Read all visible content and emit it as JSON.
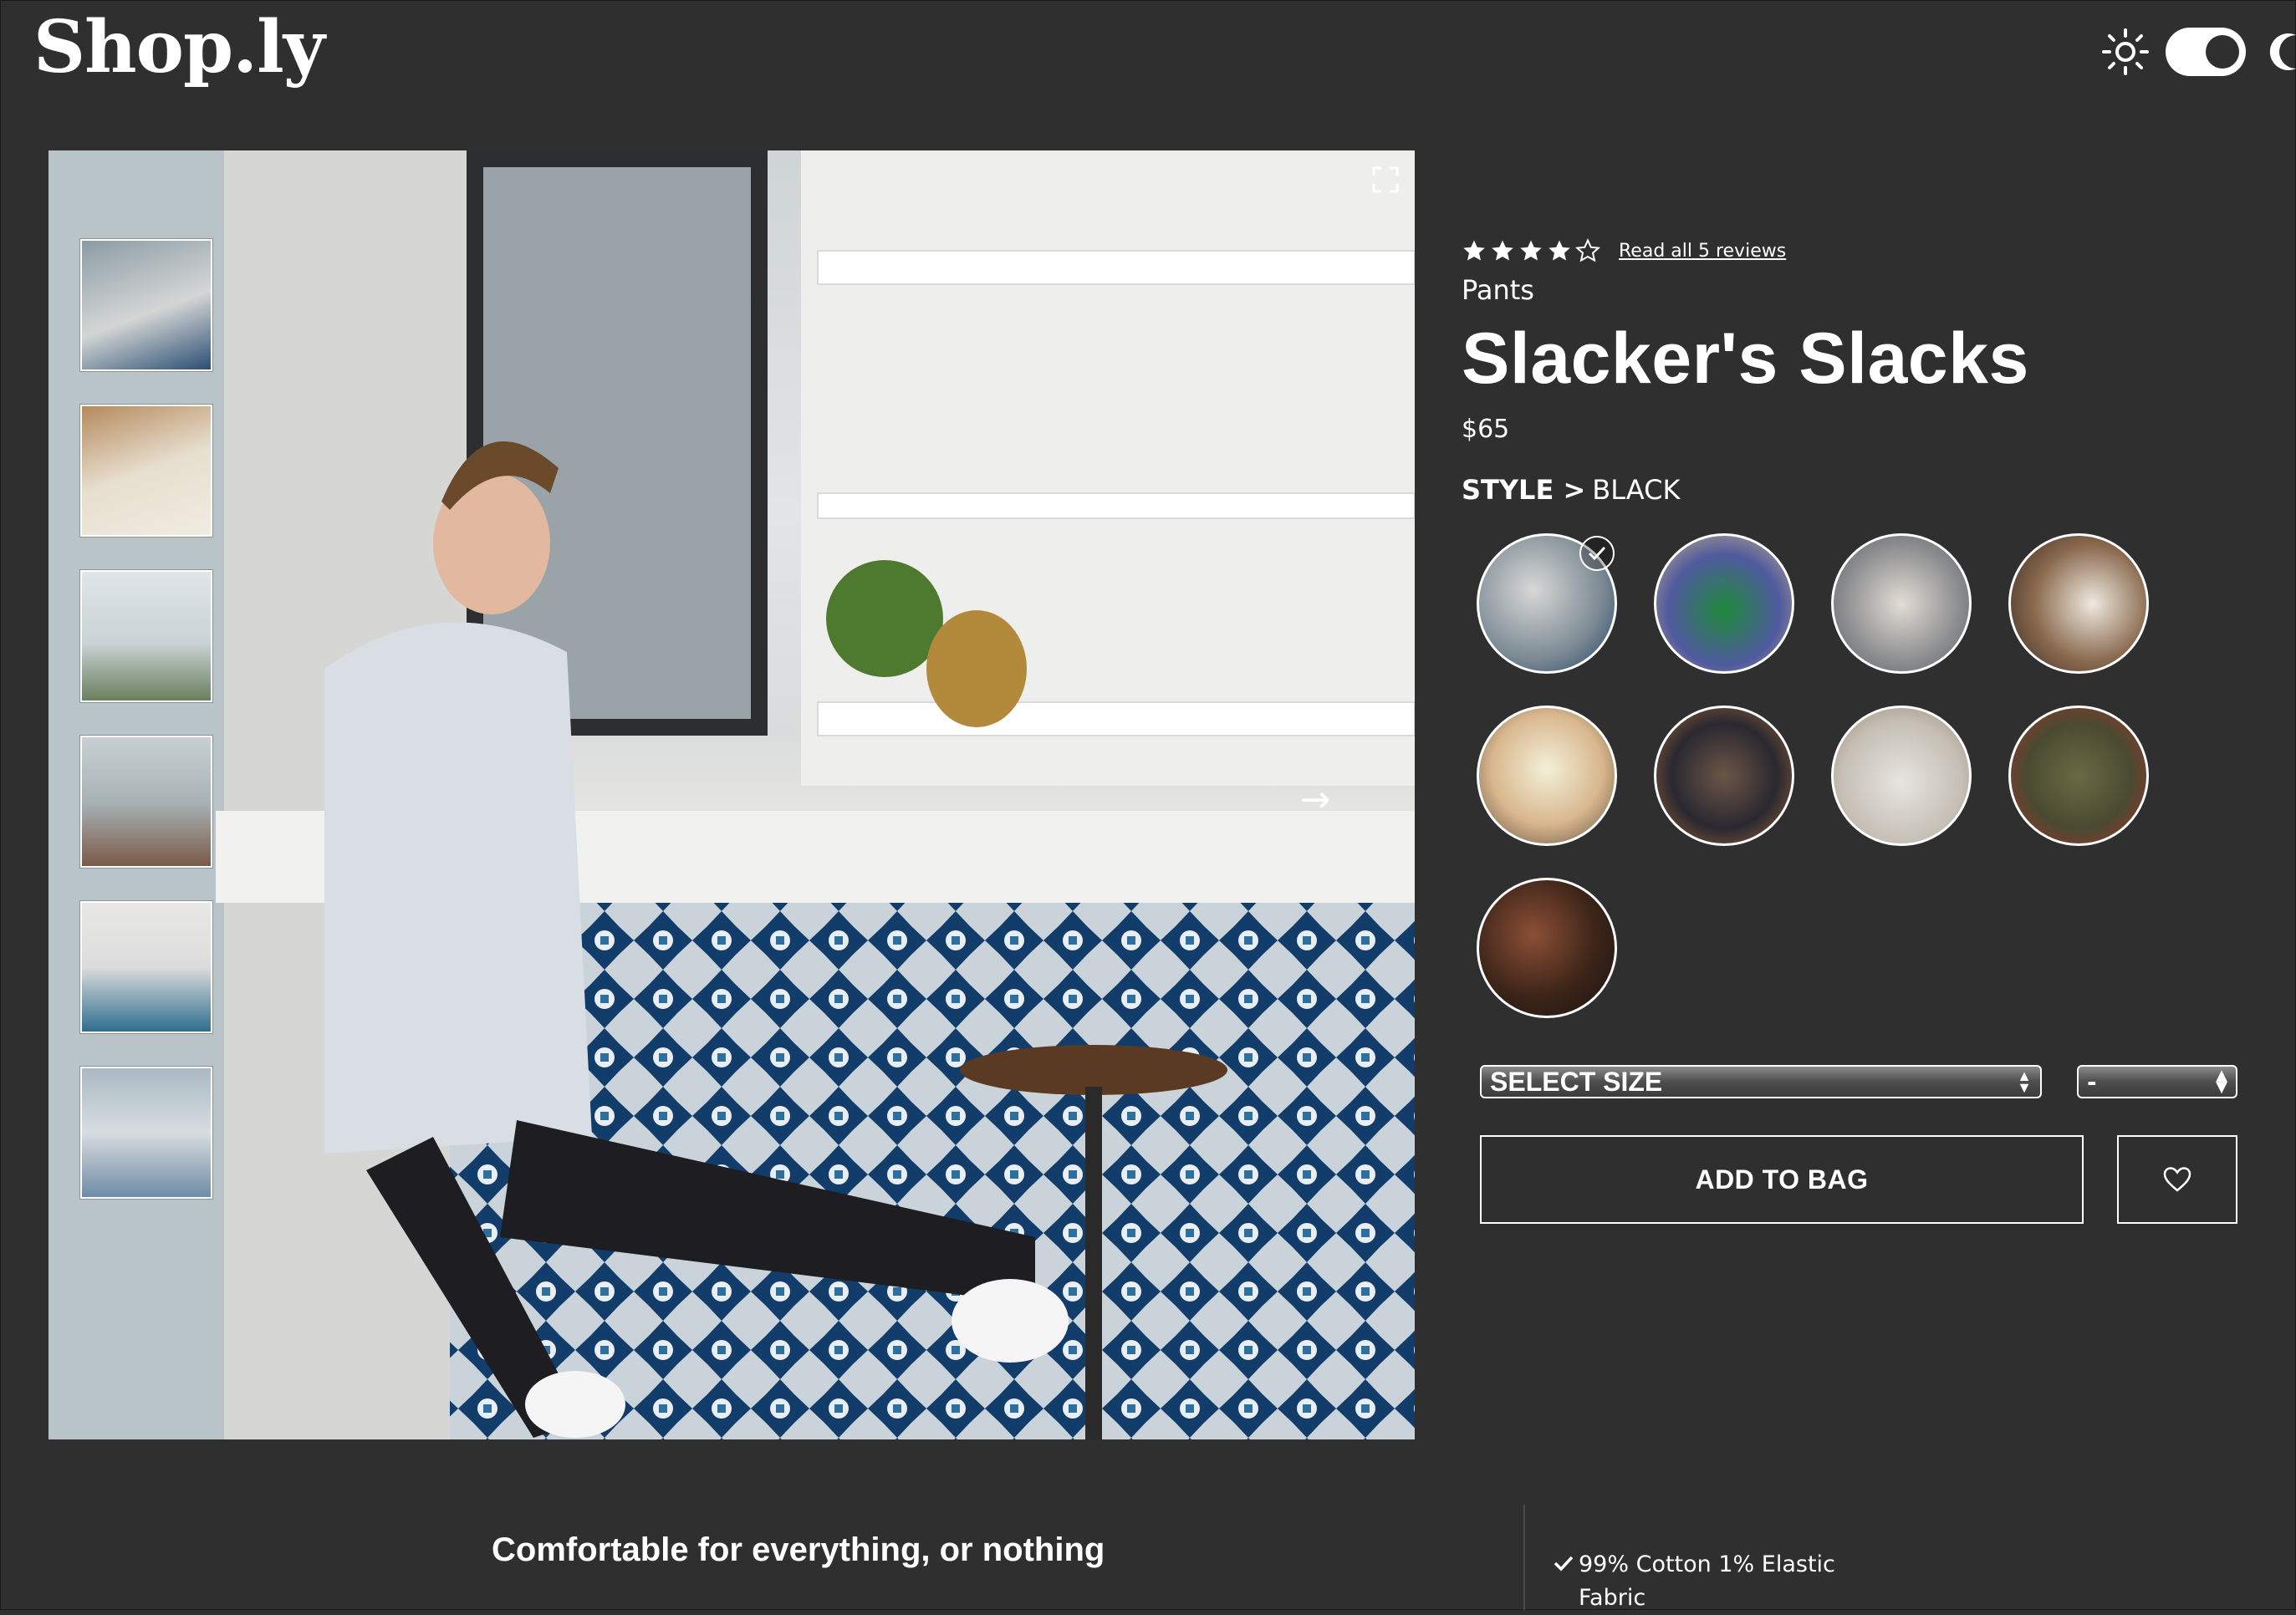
{
  "header": {
    "logo": "Shop.ly",
    "theme_icons": [
      "sun-icon",
      "moon-icon"
    ]
  },
  "gallery": {
    "thumbnail_count": 6,
    "icons": [
      "expand-icon",
      "arrow-right-icon"
    ],
    "next_arrow": "→"
  },
  "product": {
    "rating": 4,
    "rating_max": 5,
    "reviews_link": "Read all 5 reviews",
    "category": "Pants",
    "name": "Slacker's Slacks",
    "price": "$65",
    "style_label": "STYLE >",
    "style_value": "BLACK",
    "swatch_count": 9,
    "selected_swatch": 1
  },
  "controls": {
    "size_select": "SELECT SIZE",
    "qty_select": "-",
    "add_to_bag": "ADD TO BAG",
    "favorite_icon": "heart-icon"
  },
  "details": {
    "tagline": "Comfortable for everything, or nothing",
    "feature_1": "99% Cotton 1% Elastic Fabric"
  },
  "colors": {
    "background": "#2f2f2f",
    "text": "#ffffff"
  }
}
